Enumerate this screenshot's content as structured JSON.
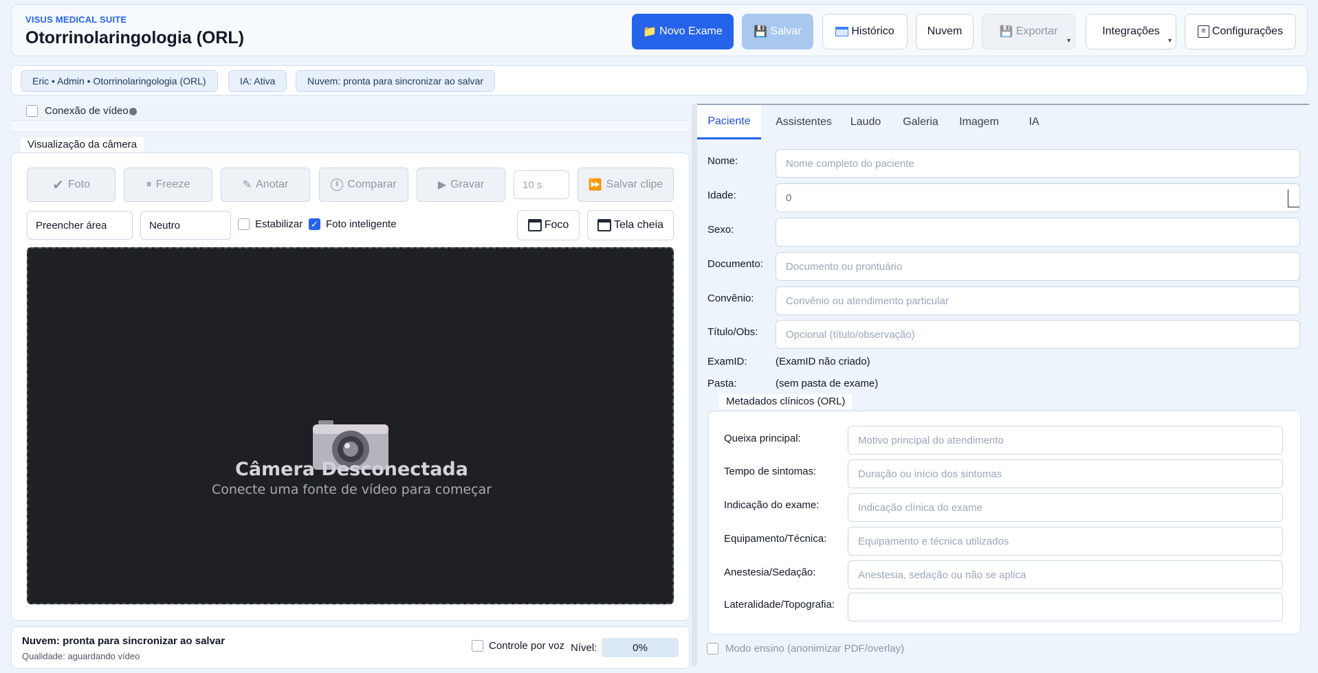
{
  "header": {
    "brand": "VISUS MEDICAL SUITE",
    "title": "Otorrinolaringologia (ORL)",
    "buttons": {
      "novo_exame": "Novo Exame",
      "salvar": "Salvar",
      "historico": "Histórico",
      "nuvem": "Nuvem",
      "exportar": "Exportar",
      "integracoes": "Integrações",
      "configuracoes": "Configurações"
    }
  },
  "status": {
    "user_chip": "Eric • Admin • Otorrinolaringologia (ORL)",
    "ia_chip": "IA: Ativa",
    "cloud_chip": "Nuvem: pronta para sincronizar ao salvar"
  },
  "video": {
    "connection_label": "Conexão de vídeo",
    "camera_legend": "Visualização da câmera",
    "controls": {
      "foto": "Foto",
      "freeze": "Freeze",
      "anotar": "Anotar",
      "comparar": "Comparar",
      "gravar": "Gravar",
      "clip_duration": "10 s",
      "salvar_clipe": "Salvar clipe"
    },
    "fill_mode": "Preencher área",
    "color_mode": "Neutro",
    "estabilizar": "Estabilizar",
    "estabilizar_checked": false,
    "foto_inteligente": "Foto inteligente",
    "foto_inteligente_checked": true,
    "foco": "Foco",
    "tela_cheia": "Tela cheia",
    "disconnected_title": "Câmera Desconectada",
    "disconnected_sub": "Conecte uma fonte de vídeo para começar"
  },
  "footer": {
    "cloud_status": "Nuvem: pronta para sincronizar ao salvar",
    "quality": "Qualidade: aguardando vídeo",
    "voice_control": "Controle por voz",
    "level_label": "Nível:",
    "level_value": "0%"
  },
  "tabs": [
    "Paciente",
    "Assistentes",
    "Laudo",
    "Galeria",
    "Imagem",
    "IA"
  ],
  "patient": {
    "nome_label": "Nome:",
    "nome_placeholder": "Nome completo do paciente",
    "idade_label": "Idade:",
    "idade_value": "0",
    "sexo_label": "Sexo:",
    "documento_label": "Documento:",
    "documento_placeholder": "Documento ou prontuário",
    "convenio_label": "Convênio:",
    "convenio_placeholder": "Convênio ou atendimento particular",
    "titulo_label": "Título/Obs:",
    "titulo_placeholder": "Opcional (título/observação)",
    "examid_label": "ExamID:",
    "examid_value": "(ExamID não criado)",
    "pasta_label": "Pasta:",
    "pasta_value": "(sem pasta de exame)"
  },
  "metadata": {
    "legend": "Metadados clínicos (ORL)",
    "queixa_label": "Queixa principal:",
    "queixa_placeholder": "Motivo principal do atendimento",
    "tempo_label": "Tempo de sintomas:",
    "tempo_placeholder": "Duração ou início dos sintomas",
    "indicacao_label": "Indicação do exame:",
    "indicacao_placeholder": "Indicação clínica do exame",
    "equipamento_label": "Equipamento/Técnica:",
    "equipamento_placeholder": "Equipamento e técnica utilizados",
    "anestesia_label": "Anestesia/Sedação:",
    "anestesia_placeholder": "Anestesia, sedação ou não se aplica",
    "lateralidade_label": "Lateralidade/Topografia:"
  },
  "teaching_mode": "Modo ensino (anonimizar PDF/overlay)"
}
